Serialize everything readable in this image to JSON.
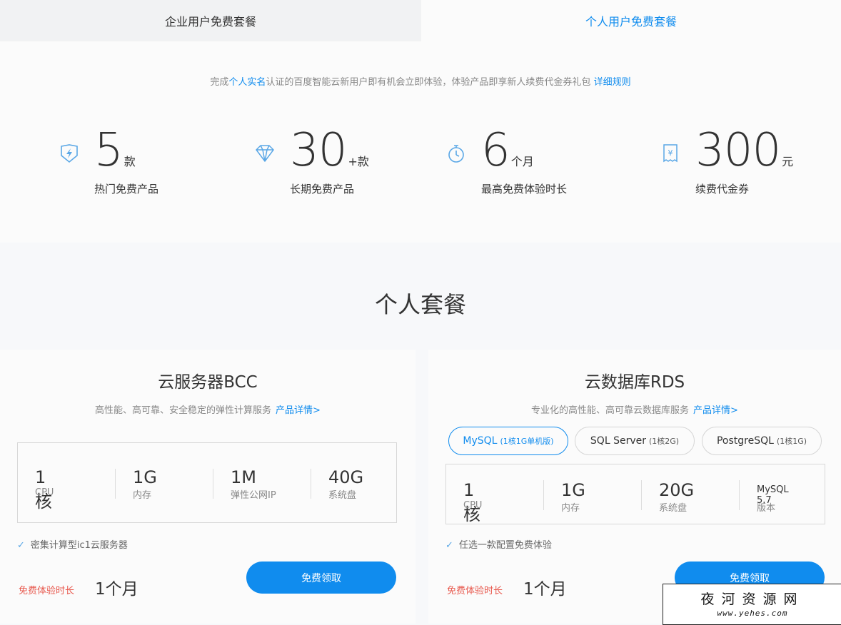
{
  "tabs": {
    "enterprise": "企业用户免费套餐",
    "personal": "个人用户免费套餐"
  },
  "intro": {
    "prefix": "完成",
    "link_realname": "个人实名",
    "middle": "认证的百度智能云新用户即有机会立即体验，体验产品即享新人续费代金券礼包",
    "link_rules": "详细规则"
  },
  "stats": [
    {
      "icon": "shield-lightning-icon",
      "value": "5",
      "unit": "款",
      "caption": "热门免费产品"
    },
    {
      "icon": "diamond-icon",
      "value": "30",
      "unit": "+款",
      "caption": "长期免费产品"
    },
    {
      "icon": "stopwatch-icon",
      "value": "6",
      "unit": "个月",
      "caption": "最高免费体验时长"
    },
    {
      "icon": "voucher-icon",
      "value": "300",
      "unit": "元",
      "caption": "续费代金券"
    }
  ],
  "section_title": "个人套餐",
  "bcc": {
    "title": "云服务器BCC",
    "desc": "高性能、高可靠、安全稳定的弹性计算服务",
    "detail_link": "产品详情>",
    "specs": [
      {
        "value": "1核",
        "label": "CPU"
      },
      {
        "value": "1G",
        "label": "内存"
      },
      {
        "value": "1M",
        "label": "弹性公网IP"
      },
      {
        "value": "40G",
        "label": "系统盘"
      }
    ],
    "check": "密集计算型ic1云服务器",
    "duration_label": "免费体验时长",
    "duration_value": "1个月",
    "button": "免费领取"
  },
  "rds": {
    "title": "云数据库RDS",
    "desc": "专业化的高性能、高可靠云数据库服务",
    "detail_link": "产品详情>",
    "options": [
      {
        "name": "MySQL",
        "spec": "(1核1G单机版)",
        "active": true
      },
      {
        "name": "SQL Server",
        "spec": "(1核2G)",
        "active": false
      },
      {
        "name": "PostgreSQL",
        "spec": "(1核1G)",
        "active": false
      }
    ],
    "specs": [
      {
        "value": "1核",
        "label": "CPU"
      },
      {
        "value": "1G",
        "label": "内存"
      },
      {
        "value": "20G",
        "label": "系统盘"
      },
      {
        "value": "MySQL 5.7",
        "label": "版本"
      }
    ],
    "check": "任选一款配置免费体验",
    "duration_label": "免费体验时长",
    "duration_value": "1个月",
    "button": "免费领取"
  },
  "watermark": {
    "title": "夜河资源网",
    "url": "www.yehes.com"
  },
  "colors": {
    "accent": "#108cee",
    "alert": "#e85a4f",
    "icon": "#5aa7e6"
  }
}
